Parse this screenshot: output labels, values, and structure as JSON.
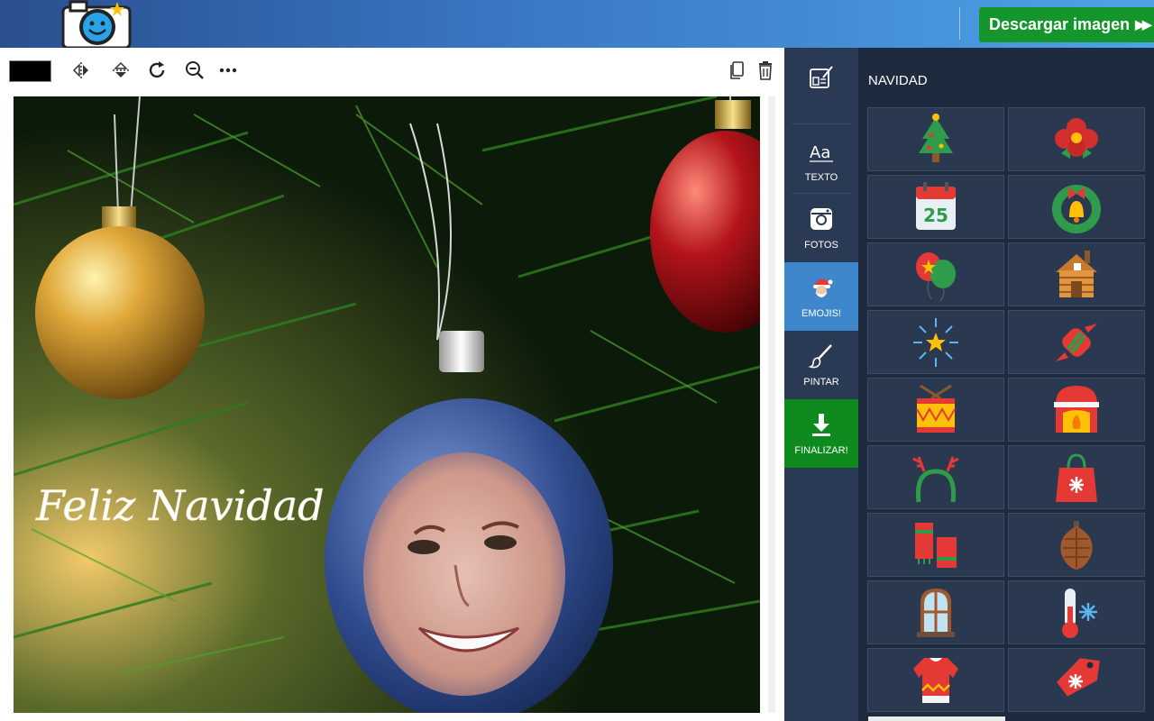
{
  "header": {
    "logo_icon": "camera-smiley-logo-icon",
    "download_label": "Descargar imagen",
    "download_arrows": "▶▶",
    "download_color": "#14962c"
  },
  "toolbar": {
    "color_value": "#000000",
    "tools": [
      "flip-horizontal-icon",
      "flip-vertical-icon",
      "rotate-icon",
      "zoom-out-icon",
      "more-icon"
    ],
    "right_tools": [
      "duplicate-icon",
      "trash-icon"
    ]
  },
  "canvas": {
    "overlay_text": "Feliz Navidad"
  },
  "sidenav": {
    "items": [
      {
        "label": "",
        "icon": "templates-icon"
      },
      {
        "label": "TEXTO",
        "icon": "text-icon"
      },
      {
        "label": "FOTOS",
        "icon": "instagram-icon"
      },
      {
        "label": "EMOJIS!",
        "icon": "santa-icon",
        "active": true
      },
      {
        "label": "PINTAR",
        "icon": "brush-icon"
      },
      {
        "label": "FINALIZAR!",
        "icon": "download-icon"
      }
    ],
    "accent_active": "#3f87cc",
    "accent_finish": "#0f8a1f"
  },
  "panel": {
    "title": "NAVIDAD",
    "emojis": [
      "christmas-tree-icon",
      "poinsettia-icon",
      "calendar-25-icon",
      "wreath-bell-icon",
      "balloons-icon",
      "log-cabin-icon",
      "fireworks-star-icon",
      "candy-icon",
      "drum-icon",
      "fireplace-icon",
      "reindeer-headband-icon",
      "gift-bag-icon",
      "scarf-icon",
      "pine-cone-icon",
      "frosted-window-icon",
      "thermometer-cold-icon",
      "ugly-sweater-icon",
      "gift-tag-icon"
    ],
    "calendar_number": "25"
  }
}
